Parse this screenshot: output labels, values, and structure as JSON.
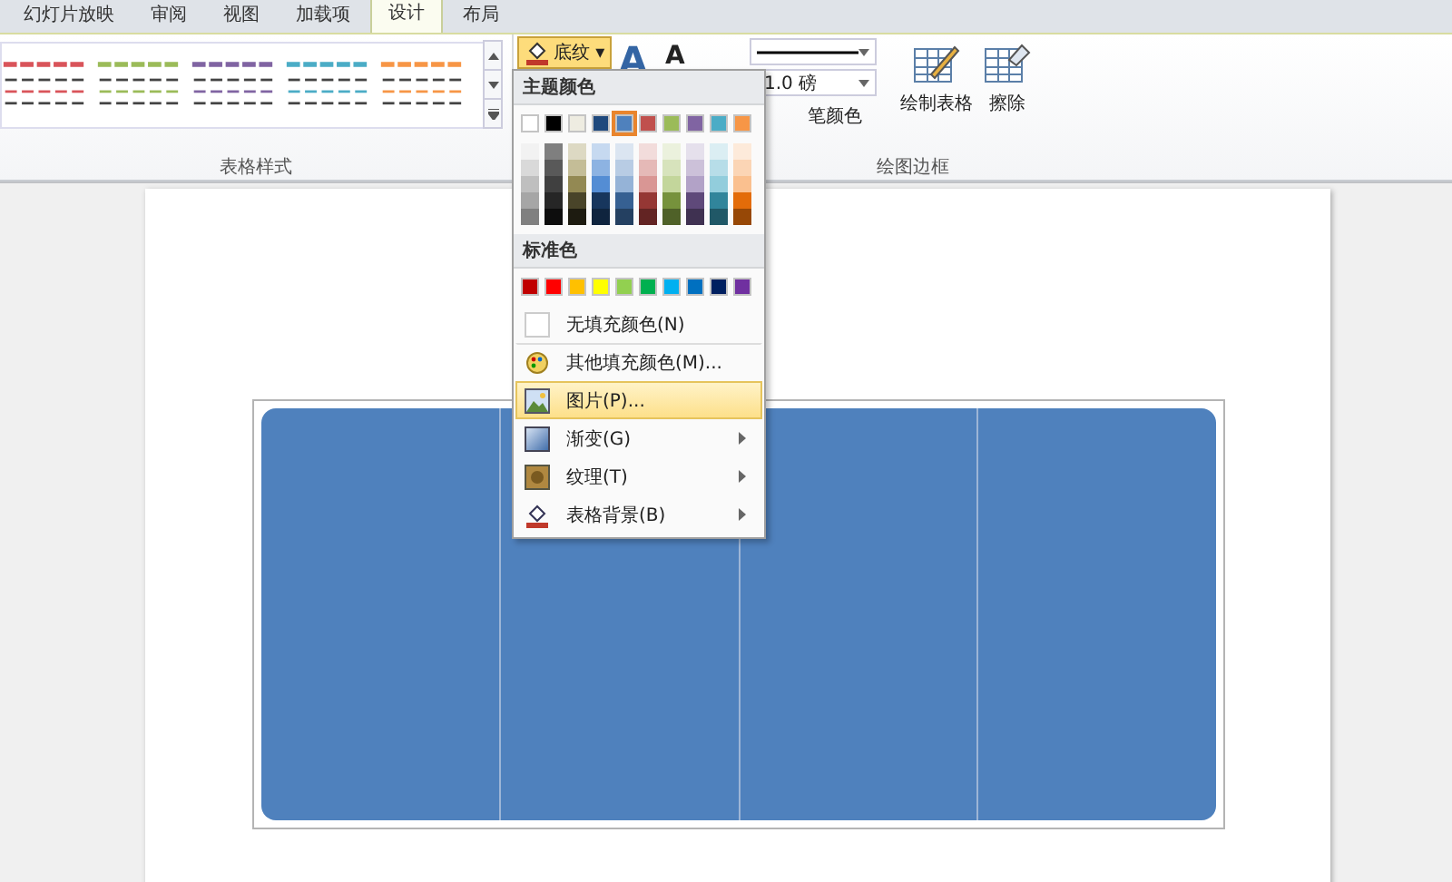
{
  "tabs": [
    {
      "label": "幻灯片放映",
      "selected": false
    },
    {
      "label": "审阅",
      "selected": false
    },
    {
      "label": "视图",
      "selected": false
    },
    {
      "label": "加载项",
      "selected": false
    },
    {
      "label": "设计",
      "selected": true
    },
    {
      "label": "布局",
      "selected": false
    }
  ],
  "ribbon": {
    "table_styles": {
      "label": "表格样式",
      "styles": [
        {
          "color": "#d9545a"
        },
        {
          "color": "#9bbb59"
        },
        {
          "color": "#8064a2"
        },
        {
          "color": "#4bacc6"
        },
        {
          "color": "#f79646"
        }
      ]
    },
    "draw_borders": {
      "label": "绘图边框",
      "shading_button": {
        "label": "底纹",
        "caret": "▾",
        "selected": true
      },
      "quick_styles_glyph": "A",
      "text_fill_glyph": "A",
      "pen_weight": "1.0 磅",
      "pen_color": "笔颜色",
      "draw_table": "绘制表格",
      "eraser": "擦除"
    }
  },
  "shading_menu": {
    "theme_header": "主题颜色",
    "theme_colors": [
      {
        "color": "#ffffff",
        "selected": false,
        "shades": [
          {
            "color": "#f2f2f2"
          },
          {
            "color": "#d9d9d9"
          },
          {
            "color": "#bfbfbf"
          },
          {
            "color": "#a6a6a6"
          },
          {
            "color": "#808080"
          }
        ]
      },
      {
        "color": "#000000",
        "selected": false,
        "shades": [
          {
            "color": "#7f7f7f"
          },
          {
            "color": "#595959"
          },
          {
            "color": "#404040"
          },
          {
            "color": "#262626"
          },
          {
            "color": "#0d0d0d"
          }
        ]
      },
      {
        "color": "#eeece1",
        "selected": false,
        "shades": [
          {
            "color": "#ddd9c3"
          },
          {
            "color": "#c4bd97"
          },
          {
            "color": "#938953"
          },
          {
            "color": "#494429"
          },
          {
            "color": "#1d1b10"
          }
        ]
      },
      {
        "color": "#1f497d",
        "selected": false,
        "shades": [
          {
            "color": "#c6d9f0"
          },
          {
            "color": "#8db3e2"
          },
          {
            "color": "#548dd4"
          },
          {
            "color": "#17365d"
          },
          {
            "color": "#0f243e"
          }
        ]
      },
      {
        "color": "#4f81bd",
        "selected": true,
        "shades": [
          {
            "color": "#dbe5f1"
          },
          {
            "color": "#b8cce4"
          },
          {
            "color": "#95b3d7"
          },
          {
            "color": "#366092"
          },
          {
            "color": "#244061"
          }
        ]
      },
      {
        "color": "#c0504d",
        "selected": false,
        "shades": [
          {
            "color": "#f2dcdb"
          },
          {
            "color": "#e5b9b7"
          },
          {
            "color": "#d99694"
          },
          {
            "color": "#953734"
          },
          {
            "color": "#632423"
          }
        ]
      },
      {
        "color": "#9bbb59",
        "selected": false,
        "shades": [
          {
            "color": "#ebf1dd"
          },
          {
            "color": "#d7e3bc"
          },
          {
            "color": "#c3d69b"
          },
          {
            "color": "#76923c"
          },
          {
            "color": "#4f6128"
          }
        ]
      },
      {
        "color": "#8064a2",
        "selected": false,
        "shades": [
          {
            "color": "#e5e0ec"
          },
          {
            "color": "#ccc1d9"
          },
          {
            "color": "#b2a2c7"
          },
          {
            "color": "#5f497a"
          },
          {
            "color": "#3f3151"
          }
        ]
      },
      {
        "color": "#4bacc6",
        "selected": false,
        "shades": [
          {
            "color": "#dbeef3"
          },
          {
            "color": "#b7dde8"
          },
          {
            "color": "#92cddc"
          },
          {
            "color": "#31859b"
          },
          {
            "color": "#205867"
          }
        ]
      },
      {
        "color": "#f79646",
        "selected": false,
        "shades": [
          {
            "color": "#fdeada"
          },
          {
            "color": "#fbd5b5"
          },
          {
            "color": "#fac08f"
          },
          {
            "color": "#e36c09"
          },
          {
            "color": "#974806"
          }
        ]
      }
    ],
    "standard_header": "标准色",
    "standard_colors": [
      {
        "color": "#c00000"
      },
      {
        "color": "#ff0000"
      },
      {
        "color": "#ffc000"
      },
      {
        "color": "#ffff00"
      },
      {
        "color": "#92d050"
      },
      {
        "color": "#00b050"
      },
      {
        "color": "#00b0f0"
      },
      {
        "color": "#0070c0"
      },
      {
        "color": "#002060"
      },
      {
        "color": "#7030a0"
      }
    ],
    "items": [
      {
        "kind": "none",
        "label": "无填充颜色(N)",
        "selected": false,
        "submenu": false
      },
      {
        "kind": "more-colors",
        "label": "其他填充颜色(M)...",
        "selected": false,
        "submenu": false
      },
      {
        "kind": "picture",
        "label": "图片(P)...",
        "selected": true,
        "submenu": false
      },
      {
        "kind": "gradient",
        "label": "渐变(G)",
        "selected": false,
        "submenu": true
      },
      {
        "kind": "texture",
        "label": "纹理(T)",
        "selected": false,
        "submenu": true
      },
      {
        "kind": "table-background",
        "label": "表格背景(B)",
        "selected": false,
        "submenu": true
      }
    ]
  }
}
